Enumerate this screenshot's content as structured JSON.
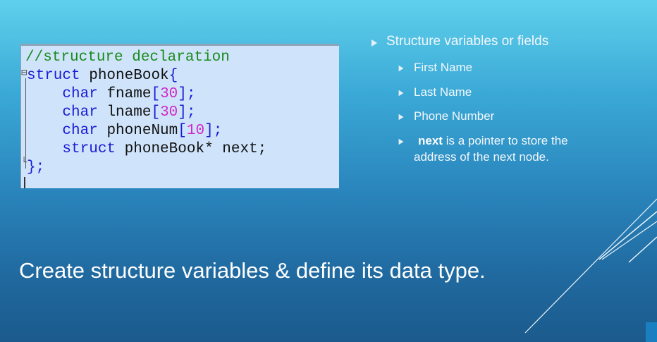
{
  "code": {
    "lines": [
      {
        "parts": [
          {
            "t": "//structure declaration",
            "c": "cm"
          }
        ]
      },
      {
        "parts": [
          {
            "t": "struct",
            "c": "kw"
          },
          {
            "t": " phoneBook",
            "c": "txt"
          },
          {
            "t": "{",
            "c": "br"
          }
        ]
      },
      {
        "parts": [
          {
            "t": "    ",
            "c": "txt"
          },
          {
            "t": "char",
            "c": "kw"
          },
          {
            "t": " fname",
            "c": "txt"
          },
          {
            "t": "[",
            "c": "br"
          },
          {
            "t": "30",
            "c": "num"
          },
          {
            "t": "];",
            "c": "br"
          }
        ]
      },
      {
        "parts": [
          {
            "t": "    ",
            "c": "txt"
          },
          {
            "t": "char",
            "c": "kw"
          },
          {
            "t": " lname",
            "c": "txt"
          },
          {
            "t": "[",
            "c": "br"
          },
          {
            "t": "30",
            "c": "num"
          },
          {
            "t": "];",
            "c": "br"
          }
        ]
      },
      {
        "parts": [
          {
            "t": "    ",
            "c": "txt"
          },
          {
            "t": "char",
            "c": "kw"
          },
          {
            "t": " phoneNum",
            "c": "txt"
          },
          {
            "t": "[",
            "c": "br"
          },
          {
            "t": "10",
            "c": "num"
          },
          {
            "t": "];",
            "c": "br"
          }
        ]
      },
      {
        "parts": [
          {
            "t": "    ",
            "c": "txt"
          },
          {
            "t": "struct",
            "c": "kw"
          },
          {
            "t": " phoneBook* next;",
            "c": "txt"
          }
        ]
      },
      {
        "parts": [
          {
            "t": "};",
            "c": "br"
          }
        ]
      }
    ]
  },
  "bullets": {
    "heading": "Structure variables or fields",
    "items": [
      "First Name",
      "Last Name",
      "Phone Number"
    ],
    "next_bold": "next",
    "next_rest_1": " is a pointer to store the",
    "next_rest_2": "address of the next node."
  },
  "caption": "Create structure variables & define its data type.",
  "colors": {
    "keyword": "#1a1ad6",
    "comment": "#1a8a1a",
    "number": "#d028c8",
    "code_bg": "#cfe4fb"
  }
}
